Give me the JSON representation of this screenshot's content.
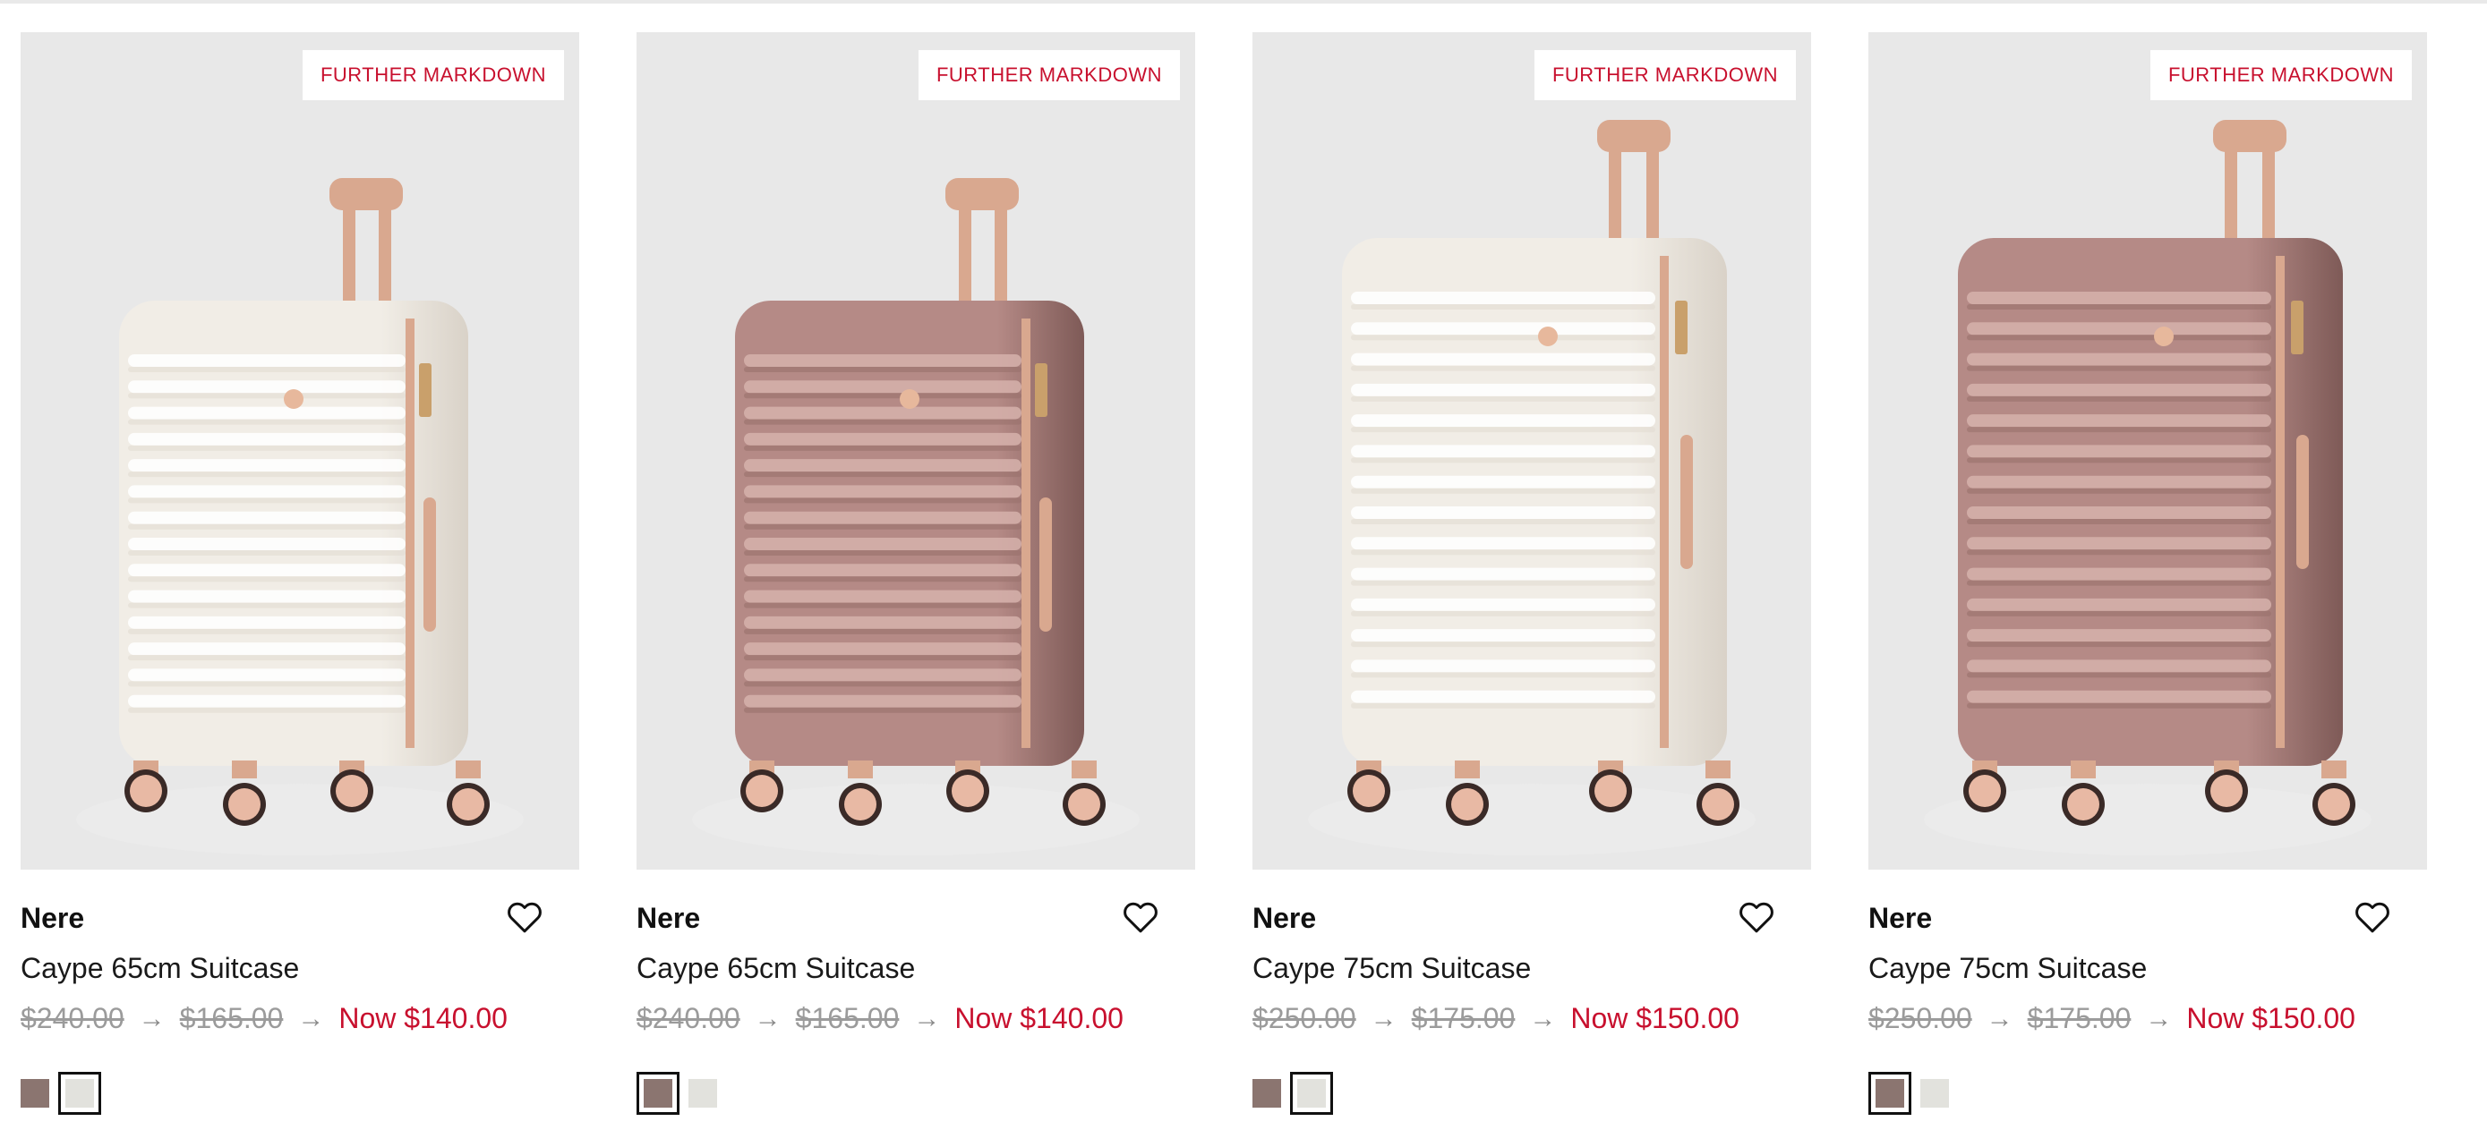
{
  "colors": {
    "markdown_red": "#c8102e",
    "swatch_rose": "#8b7570",
    "swatch_cream": "#e2e2dd",
    "card_bg": "#e8e8e8"
  },
  "products": [
    {
      "badge": "FURTHER MARKDOWN",
      "brand": "Nere",
      "name": "Caype 65cm Suitcase",
      "price_original": "$240.00",
      "price_reduced": "$165.00",
      "price_now": "Now $140.00",
      "arrow": "→",
      "image_color": "cream",
      "selected_swatch": 1,
      "swatches": [
        "rose",
        "cream"
      ]
    },
    {
      "badge": "FURTHER MARKDOWN",
      "brand": "Nere",
      "name": "Caype 65cm Suitcase",
      "price_original": "$240.00",
      "price_reduced": "$165.00",
      "price_now": "Now $140.00",
      "arrow": "→",
      "image_color": "rose",
      "selected_swatch": 0,
      "swatches": [
        "rose",
        "cream"
      ]
    },
    {
      "badge": "FURTHER MARKDOWN",
      "brand": "Nere",
      "name": "Caype 75cm Suitcase",
      "price_original": "$250.00",
      "price_reduced": "$175.00",
      "price_now": "Now $150.00",
      "arrow": "→",
      "image_color": "cream",
      "selected_swatch": 1,
      "swatches": [
        "rose",
        "cream"
      ]
    },
    {
      "badge": "FURTHER MARKDOWN",
      "brand": "Nere",
      "name": "Caype 75cm Suitcase",
      "price_original": "$250.00",
      "price_reduced": "$175.00",
      "price_now": "Now $150.00",
      "arrow": "→",
      "image_color": "rose",
      "selected_swatch": 0,
      "swatches": [
        "rose",
        "cream"
      ]
    }
  ]
}
